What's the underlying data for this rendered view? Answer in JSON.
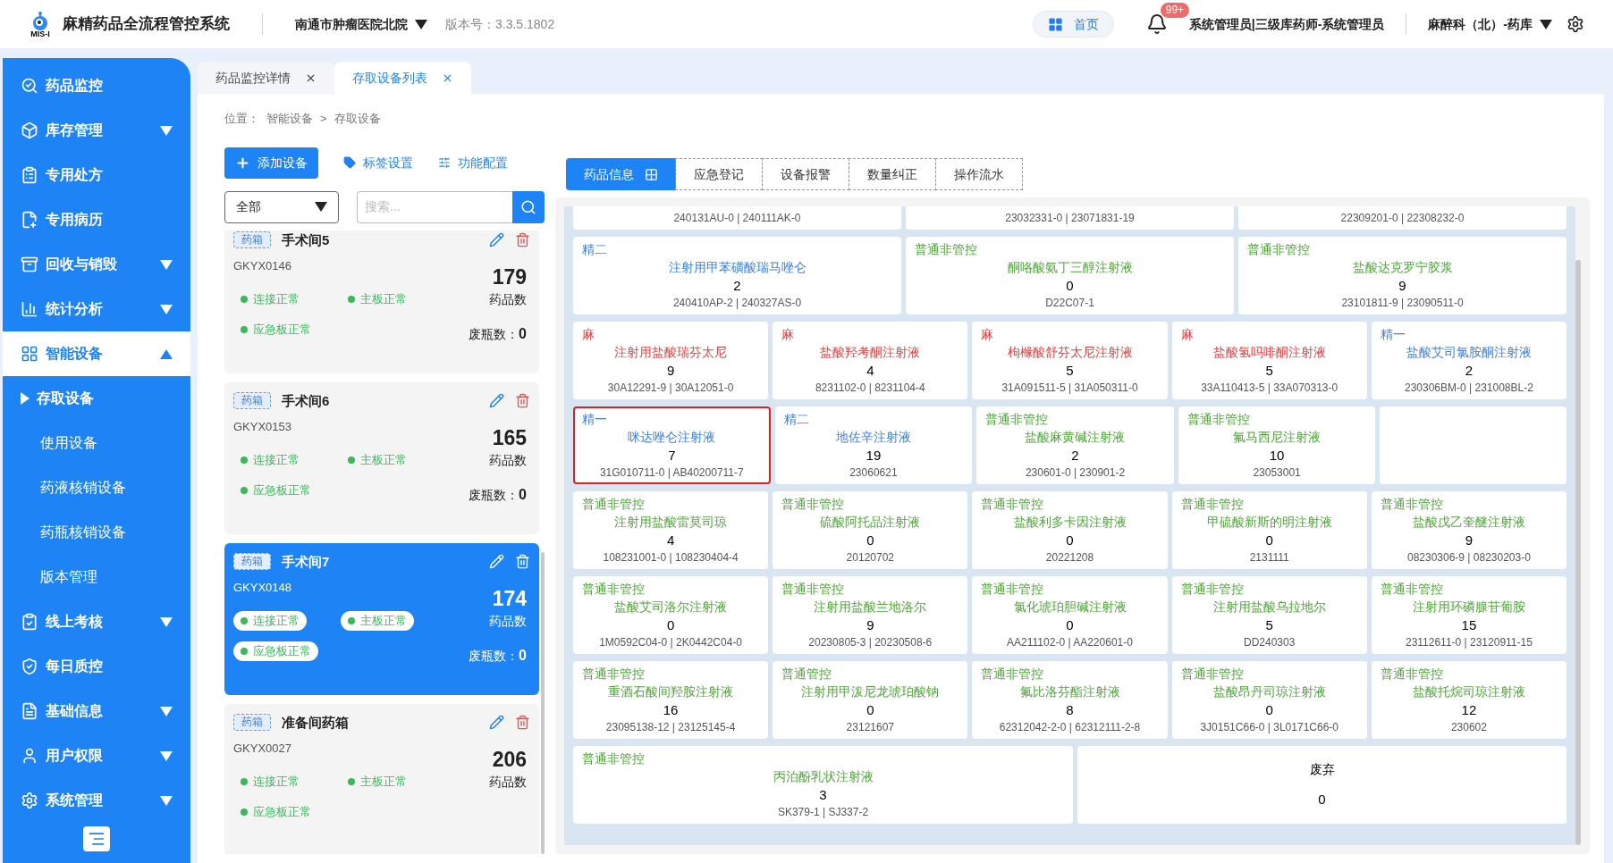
{
  "header": {
    "logo_text": "MIS-I",
    "title": "麻精药品全流程管控系统",
    "hospital": "南通市肿瘤医院北院",
    "version": "版本号：3.3.5.1802",
    "home": "首页",
    "badge": "99+",
    "user": "系统管理员|三级库药师-系统管理员",
    "dept": "麻醉科（北）-药库"
  },
  "sidebar": {
    "items": [
      {
        "label": "药品监控",
        "expandable": false,
        "selected": false
      },
      {
        "label": "库存管理",
        "expandable": true,
        "expanded": false,
        "selected": false
      },
      {
        "label": "专用处方",
        "expandable": false,
        "selected": false
      },
      {
        "label": "专用病历",
        "expandable": false,
        "selected": false
      },
      {
        "label": "回收与销毁",
        "expandable": true,
        "expanded": false,
        "selected": false
      },
      {
        "label": "统计分析",
        "expandable": true,
        "expanded": false,
        "selected": false
      },
      {
        "label": "智能设备",
        "expandable": true,
        "expanded": true,
        "selected": true,
        "children": [
          {
            "label": "存取设备",
            "selected": true
          },
          {
            "label": "使用设备",
            "selected": false
          },
          {
            "label": "药液核销设备",
            "selected": false
          },
          {
            "label": "药瓶核销设备",
            "selected": false
          },
          {
            "label": "版本管理",
            "selected": false
          }
        ]
      },
      {
        "label": "线上考核",
        "expandable": true,
        "expanded": false,
        "selected": false
      },
      {
        "label": "每日质控",
        "expandable": false,
        "selected": false
      },
      {
        "label": "基础信息",
        "expandable": true,
        "expanded": false,
        "selected": false
      },
      {
        "label": "用户权限",
        "expandable": true,
        "expanded": false,
        "selected": false
      },
      {
        "label": "系统管理",
        "expandable": true,
        "expanded": false,
        "selected": false
      }
    ]
  },
  "tabs": [
    {
      "label": "药品监控详情",
      "selected": false
    },
    {
      "label": "存取设备列表",
      "selected": true
    }
  ],
  "breadcrumb": {
    "label": "位置：",
    "items": [
      "智能设备",
      "存取设备"
    ],
    "separator": ">"
  },
  "toolbar": {
    "add": "添加设备",
    "tags": "标签设置",
    "config": "功能配置"
  },
  "filter": {
    "value": "全部",
    "placeholder": "搜索..."
  },
  "devices": [
    {
      "tag": "药箱",
      "name": "手术间5",
      "code": "GKYX0146",
      "statuses": [
        "连接正常",
        "主板正常",
        "应急板正常"
      ],
      "count": "179",
      "count_label": "药品数",
      "waste_label": "废瓶数：",
      "waste": "0",
      "selected": false
    },
    {
      "tag": "药箱",
      "name": "手术间6",
      "code": "GKYX0153",
      "statuses": [
        "连接正常",
        "主板正常",
        "应急板正常"
      ],
      "count": "165",
      "count_label": "药品数",
      "waste_label": "废瓶数：",
      "waste": "0",
      "selected": false
    },
    {
      "tag": "药箱",
      "name": "手术间7",
      "code": "GKYX0148",
      "statuses": [
        "连接正常",
        "主板正常",
        "应急板正常"
      ],
      "count": "174",
      "count_label": "药品数",
      "waste_label": "废瓶数：",
      "waste": "0",
      "selected": true
    },
    {
      "tag": "药箱",
      "name": "准备间药箱",
      "code": "GKYX0027",
      "statuses": [
        "连接正常",
        "主板正常",
        "应急板正常"
      ],
      "count": "206",
      "count_label": "药品数",
      "selected": false
    }
  ],
  "detail_tabs": [
    {
      "label": "药品信息",
      "selected": true
    },
    {
      "label": "应急登记",
      "selected": false
    },
    {
      "label": "设备报警",
      "selected": false
    },
    {
      "label": "数量纠正",
      "selected": false
    },
    {
      "label": "操作流水",
      "selected": false
    }
  ],
  "grid": [
    [
      {
        "kind": "partial",
        "batch": "240131AU-0 | 240111AK-0"
      },
      {
        "kind": "partial",
        "batch": "23032331-0 | 23071831-19"
      },
      {
        "kind": "partial",
        "batch": "22309201-0 | 22308232-0"
      }
    ],
    [
      {
        "kind": "drug",
        "category": "精二",
        "color": "#3f7fe6",
        "name": "注射用甲苯磺酸瑞马唑仑",
        "qty": "2",
        "batch": "240410AP-2 | 240327AS-0",
        "selected": false
      },
      {
        "kind": "drug",
        "category": "普通非管控",
        "color": "#4ea838",
        "name": "酮咯酸氨丁三醇注射液",
        "qty": "0",
        "batch": "D22C07-1",
        "selected": false
      },
      {
        "kind": "drug",
        "category": "普通非管控",
        "color": "#4ea838",
        "name": "盐酸达克罗宁胶浆",
        "qty": "9",
        "batch": "23101811-9 | 23090511-0",
        "selected": false
      }
    ],
    [
      {
        "kind": "drug",
        "category": "麻",
        "color": "#ee3b3b",
        "name": "注射用盐酸瑞芬太尼",
        "qty": "9",
        "batch": "30A12291-9 | 30A12051-0",
        "selected": false
      },
      {
        "kind": "drug",
        "category": "麻",
        "color": "#ee3b3b",
        "name": "盐酸羟考酮注射液",
        "qty": "4",
        "batch": "8231102-0 | 8231104-4",
        "selected": false
      },
      {
        "kind": "drug",
        "category": "麻",
        "color": "#ee3b3b",
        "name": "枸橼酸舒芬太尼注射液",
        "qty": "5",
        "batch": "31A091511-5 | 31A050311-0",
        "selected": false
      },
      {
        "kind": "drug",
        "category": "麻",
        "color": "#ee3b3b",
        "name": "盐酸氢吗啡酮注射液",
        "qty": "5",
        "batch": "33A110413-5 | 33A070313-0",
        "selected": false
      },
      {
        "kind": "drug",
        "category": "精一",
        "color": "#3f7fe6",
        "name": "盐酸艾司氯胺酮注射液",
        "qty": "2",
        "batch": "230306BM-0 | 231008BL-2",
        "selected": false
      }
    ],
    [
      {
        "kind": "drug",
        "category": "精一",
        "color": "#3f7fe6",
        "name": "咪达唑仑注射液",
        "qty": "7",
        "batch": "31G010711-0 | AB40200711-7",
        "selected": true
      },
      {
        "kind": "drug",
        "category": "精二",
        "color": "#3f7fe6",
        "name": "地佐辛注射液",
        "qty": "19",
        "batch": "23060621",
        "selected": false
      },
      {
        "kind": "drug",
        "category": "普通非管控",
        "color": "#4ea838",
        "name": "盐酸麻黄碱注射液",
        "qty": "2",
        "batch": "230601-0 | 230901-2",
        "selected": false
      },
      {
        "kind": "drug",
        "category": "普通非管控",
        "color": "#4ea838",
        "name": "氟马西尼注射液",
        "qty": "10",
        "batch": "23053001",
        "selected": false
      },
      {
        "kind": "empty"
      }
    ],
    [
      {
        "kind": "drug",
        "category": "普通非管控",
        "color": "#4ea838",
        "name": "注射用盐酸雷莫司琼",
        "qty": "4",
        "batch": "108231001-0 | 108230404-4",
        "selected": false
      },
      {
        "kind": "drug",
        "category": "普通非管控",
        "color": "#4ea838",
        "name": "硫酸阿托品注射液",
        "qty": "0",
        "batch": "20120702",
        "selected": false
      },
      {
        "kind": "drug",
        "category": "普通非管控",
        "color": "#4ea838",
        "name": "盐酸利多卡因注射液",
        "qty": "0",
        "batch": "20221208",
        "selected": false
      },
      {
        "kind": "drug",
        "category": "普通非管控",
        "color": "#4ea838",
        "name": "甲硫酸新斯的明注射液",
        "qty": "0",
        "batch": "2131111",
        "selected": false
      },
      {
        "kind": "drug",
        "category": "普通非管控",
        "color": "#4ea838",
        "name": "盐酸戊乙奎醚注射液",
        "qty": "9",
        "batch": "08230306-9 | 08230203-0",
        "selected": false
      }
    ],
    [
      {
        "kind": "drug",
        "category": "普通非管控",
        "color": "#4ea838",
        "name": "盐酸艾司洛尔注射液",
        "qty": "0",
        "batch": "1M0592C04-0 | 2K0442C04-0",
        "selected": false
      },
      {
        "kind": "drug",
        "category": "普通非管控",
        "color": "#4ea838",
        "name": "注射用盐酸兰地洛尔",
        "qty": "9",
        "batch": "20230805-3 | 20230508-6",
        "selected": false
      },
      {
        "kind": "drug",
        "category": "普通非管控",
        "color": "#4ea838",
        "name": "氯化琥珀胆碱注射液",
        "qty": "0",
        "batch": "AA211102-0 | AA220601-0",
        "selected": false
      },
      {
        "kind": "drug",
        "category": "普通非管控",
        "color": "#4ea838",
        "name": "注射用盐酸乌拉地尔",
        "qty": "5",
        "batch": "DD240303",
        "selected": false
      },
      {
        "kind": "drug",
        "category": "普通非管控",
        "color": "#4ea838",
        "name": "注射用环磷腺苷葡胺",
        "qty": "15",
        "batch": "23112611-0 | 23120911-15",
        "selected": false
      }
    ],
    [
      {
        "kind": "drug",
        "category": "普通非管控",
        "color": "#4ea838",
        "name": "重酒石酸间羟胺注射液",
        "qty": "16",
        "batch": "23095138-12 | 23125145-4",
        "selected": false
      },
      {
        "kind": "drug",
        "category": "普通管控",
        "color": "#4ea838",
        "name": "注射用甲泼尼龙琥珀酸钠",
        "qty": "0",
        "batch": "23121607",
        "selected": false
      },
      {
        "kind": "drug",
        "category": "普通非管控",
        "color": "#4ea838",
        "name": "氟比洛芬酯注射液",
        "qty": "8",
        "batch": "62312042-2-0 | 62312111-2-8",
        "selected": false
      },
      {
        "kind": "drug",
        "category": "普通非管控",
        "color": "#4ea838",
        "name": "盐酸昂丹司琼注射液",
        "qty": "0",
        "batch": "3J0151C66-0 | 3L0171C66-0",
        "selected": false
      },
      {
        "kind": "drug",
        "category": "普通非管控",
        "color": "#4ea838",
        "name": "盐酸托烷司琼注射液",
        "qty": "12",
        "batch": "230602",
        "selected": false
      }
    ],
    [
      {
        "kind": "drug",
        "category": "普通非管控",
        "color": "#4ea838",
        "name": "丙泊酚乳状注射液",
        "qty": "3",
        "batch": "SK379-1 | SJ337-2",
        "selected": false
      },
      {
        "kind": "discard",
        "label": "废弃",
        "qty": "0"
      }
    ]
  ]
}
